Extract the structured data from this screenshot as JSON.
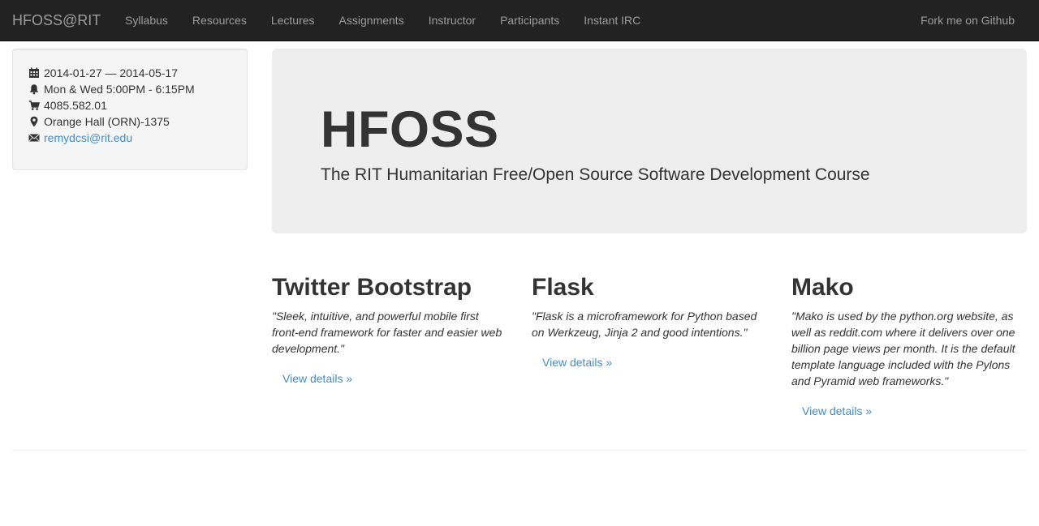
{
  "navbar": {
    "brand": "HFOSS@RIT",
    "items": [
      {
        "label": "Syllabus"
      },
      {
        "label": "Resources"
      },
      {
        "label": "Lectures"
      },
      {
        "label": "Assignments"
      },
      {
        "label": "Instructor"
      },
      {
        "label": "Participants"
      },
      {
        "label": "Instant IRC"
      }
    ],
    "fork_label": "Fork me on Github"
  },
  "sidebar": {
    "dates": "2014-01-27 — 2014-05-17",
    "schedule": "Mon & Wed 5:00PM - 6:15PM",
    "course_number": "4085.582.01",
    "location": "Orange Hall (ORN)-1375",
    "email": "remydcsi@rit.edu",
    "icons": [
      "calendar-icon",
      "bell-icon",
      "cart-icon",
      "map-marker-icon",
      "envelope-icon"
    ]
  },
  "jumbotron": {
    "title": "HFOSS",
    "subtitle": "The RIT Humanitarian Free/Open Source Software Development Course"
  },
  "features": [
    {
      "title": "Twitter Bootstrap",
      "quote": "\"Sleek, intuitive, and powerful mobile first front-end framework for faster and easier web development.\"",
      "link": "View details »"
    },
    {
      "title": "Flask",
      "quote": "\"Flask is a microframework for Python based on Werkzeug, Jinja 2 and good intentions.\"",
      "link": "View details »"
    },
    {
      "title": "Mako",
      "quote": "\"Mako is used by the python.org website, as well as reddit.com where it delivers over one billion page views per month. It is the default template language included with the Pylons and Pyramid web frameworks.\"",
      "link": "View details »"
    }
  ],
  "colors": {
    "navbar_bg": "#222222",
    "nav_text": "#9d9d9d",
    "link": "#428bca",
    "jumbotron_bg": "#eeeeee",
    "well_bg": "#f5f5f5",
    "text": "#333333"
  }
}
